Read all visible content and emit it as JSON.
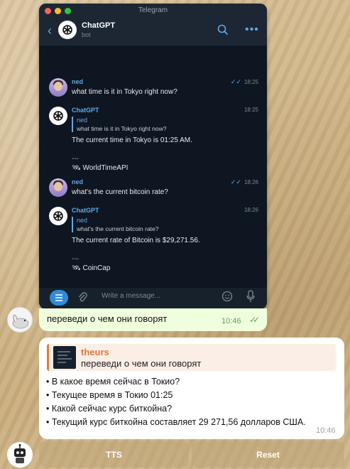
{
  "screenshot": {
    "window_title": "Telegram",
    "chat": {
      "name": "ChatGPT",
      "status": "bot"
    },
    "messages": [
      {
        "sender": "ned",
        "time": "18:25",
        "text": "what time is it in Tokyo right now?"
      },
      {
        "sender": "ChatGPT",
        "time": "18:25",
        "quote_name": "ned",
        "quote_text": "what time is it in Tokyo right now?",
        "answer": "The current time in Tokyo is 01:25 AM.",
        "separator": "---",
        "source": "WorldTimeAPI"
      },
      {
        "sender": "ned",
        "time": "18:26",
        "text": "what's the current bitcoin rate?"
      },
      {
        "sender": "ChatGPT",
        "time": "18:26",
        "quote_name": "ned",
        "quote_text": "what's the current bitcoin rate?",
        "answer": "The current rate of Bitcoin is $29,271.56.",
        "separator": "---",
        "source": "CoinCap"
      }
    ],
    "input_placeholder": "Write a message..."
  },
  "outgoing": {
    "text": "переведи о чем они говорят",
    "time": "10:46"
  },
  "reply": {
    "reply_to_name": "theurs",
    "reply_to_text": "переведи о чем они говорят",
    "lines": [
      "• В какое время сейчас в Токио?",
      "• Текущее время в Токио 01:25",
      "• Какой сейчас курс биткойна?",
      "• Текущий курс биткойна составляет 29 271,56 долларов США."
    ],
    "time": "10:46"
  },
  "keyboard": {
    "buttons": [
      "TTS",
      "Reset"
    ]
  },
  "colors": {
    "accent": "#5fa8e8",
    "reply_accent": "#e17a3c",
    "outgoing_bubble": "#effedd"
  },
  "icons": [
    "back-icon",
    "search-icon",
    "more-icon",
    "menu-icon",
    "attach-icon",
    "emoji-icon",
    "mic-icon",
    "double-check-icon"
  ]
}
